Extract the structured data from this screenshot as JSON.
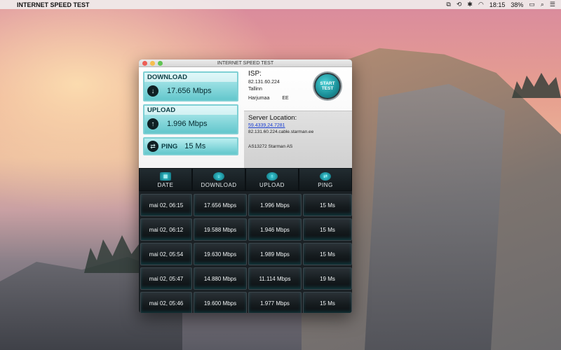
{
  "menubar": {
    "app_name": "INTERNET SPEED TEST",
    "time": "18:15",
    "battery": "38%"
  },
  "window": {
    "title": "INTERNET SPEED TEST"
  },
  "download": {
    "label": "DOWNLOAD",
    "value": "17.656 Mbps"
  },
  "upload": {
    "label": "UPLOAD",
    "value": "1.996 Mbps"
  },
  "ping": {
    "label": "PING",
    "value": "15 Ms"
  },
  "isp": {
    "title": "ISP:",
    "ip": "82.131.60.224",
    "city": "Tallinn",
    "region": "Harjumaa",
    "country": "EE"
  },
  "start_button": {
    "line1": "START",
    "line2": "TEST"
  },
  "server": {
    "title": "Server Location:",
    "coords": "59.4339,24.7281",
    "host": "82.131.60.224.cable.starman.ee",
    "as": "AS13272 Starman AS"
  },
  "headers": [
    {
      "label": "DATE",
      "icon": "calendar-icon"
    },
    {
      "label": "DOWNLOAD",
      "icon": "download-icon"
    },
    {
      "label": "UPLOAD",
      "icon": "upload-icon"
    },
    {
      "label": "PING",
      "icon": "ping-icon"
    }
  ],
  "history": [
    {
      "date": "mai 02, 06:15",
      "download": "17.656 Mbps",
      "upload": "1.996 Mbps",
      "ping": "15 Ms"
    },
    {
      "date": "mai 02, 06:12",
      "download": "19.588 Mbps",
      "upload": "1.946 Mbps",
      "ping": "15 Ms"
    },
    {
      "date": "mai 02, 05:54",
      "download": "19.630 Mbps",
      "upload": "1.989 Mbps",
      "ping": "15 Ms"
    },
    {
      "date": "mai 02, 05:47",
      "download": "14.880 Mbps",
      "upload": "11.114 Mbps",
      "ping": "19 Ms"
    },
    {
      "date": "mai 02, 05:46",
      "download": "19.600 Mbps",
      "upload": "1.977 Mbps",
      "ping": "15 Ms"
    }
  ],
  "colors": {
    "accent": "#63c7cc",
    "panel_dark": "#1a2024",
    "link": "#1a3fd1"
  }
}
